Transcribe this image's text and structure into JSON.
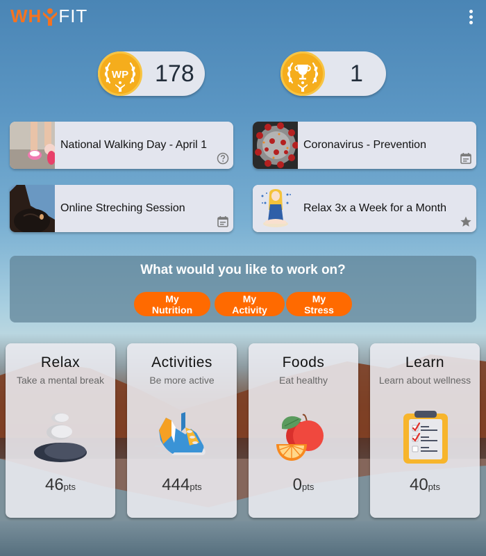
{
  "app": {
    "logo_prefix": "WH",
    "logo_suffix": "FIT",
    "menu_icon": "more-vert-icon"
  },
  "stats": {
    "wellness_points": {
      "badge_label": "WP",
      "value": "178",
      "icon": "wp-laurel-badge-icon"
    },
    "trophies": {
      "value": "1",
      "icon": "trophy-laurel-badge-icon"
    }
  },
  "events": [
    {
      "title": "National Walking Day - April 1",
      "thumb": "walking-shoes-photo",
      "icon": "help-circle-icon"
    },
    {
      "title": "Coronavirus - Prevention",
      "thumb": "coronavirus-image",
      "icon": "event-note-icon"
    },
    {
      "title": "Online Streching Session",
      "thumb": "stretching-photo",
      "icon": "event-note-icon"
    },
    {
      "title": "Relax 3x a Week for a Month",
      "thumb": "meditation-illustration",
      "icon": "star-icon"
    }
  ],
  "focus": {
    "title": "What would you like to work on?",
    "buttons": [
      "My Nutrition",
      "My Activity",
      "My Stress"
    ],
    "accent": "#ff6a00"
  },
  "categories": [
    {
      "title": "Relax",
      "subtitle": "Take a mental break",
      "points": "46",
      "unit": "pts",
      "icon": "stacked-stones-icon"
    },
    {
      "title": "Activities",
      "subtitle": "Be more active",
      "points": "444",
      "unit": "pts",
      "icon": "running-shoe-icon"
    },
    {
      "title": "Foods",
      "subtitle": "Eat healthy",
      "points": "0",
      "unit": "pts",
      "icon": "apple-orange-icon"
    },
    {
      "title": "Learn",
      "subtitle": "Learn about wellness",
      "points": "40",
      "unit": "pts",
      "icon": "clipboard-checklist-icon"
    }
  ],
  "colors": {
    "brand_orange": "#f47320",
    "badge_gold": "#f5ad1c",
    "card_bg": "#e3e5ee"
  }
}
